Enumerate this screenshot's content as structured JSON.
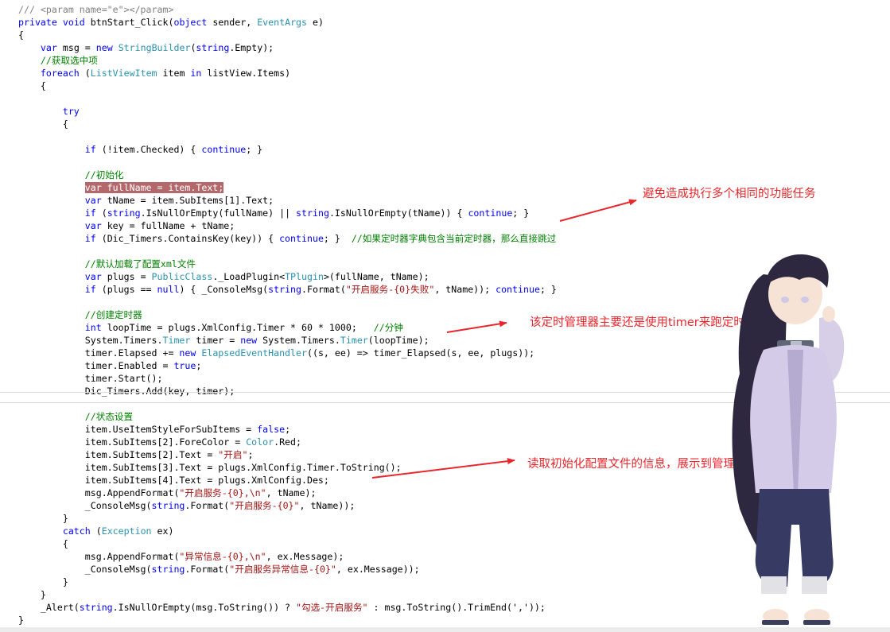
{
  "code_lines": [
    [
      [
        "doc",
        "/// <param name=\"e\"></param>"
      ]
    ],
    [
      [
        "kw",
        "private"
      ],
      [
        "t",
        " "
      ],
      [
        "kw",
        "void"
      ],
      [
        "t",
        " btnStart_Click("
      ],
      [
        "kw",
        "object"
      ],
      [
        "t",
        " sender, "
      ],
      [
        "ty",
        "EventArgs"
      ],
      [
        "t",
        " e)"
      ]
    ],
    [
      [
        "t",
        "{"
      ]
    ],
    [
      [
        "t",
        "    "
      ],
      [
        "kw",
        "var"
      ],
      [
        "t",
        " msg = "
      ],
      [
        "kw",
        "new"
      ],
      [
        "t",
        " "
      ],
      [
        "ty",
        "StringBuilder"
      ],
      [
        "t",
        "("
      ],
      [
        "kw",
        "string"
      ],
      [
        "t",
        ".Empty);"
      ]
    ],
    [
      [
        "t",
        "    "
      ],
      [
        "cmt",
        "//获取选中项"
      ]
    ],
    [
      [
        "t",
        "    "
      ],
      [
        "kw",
        "foreach"
      ],
      [
        "t",
        " ("
      ],
      [
        "ty",
        "ListViewItem"
      ],
      [
        "t",
        " item "
      ],
      [
        "kw",
        "in"
      ],
      [
        "t",
        " listView.Items)"
      ]
    ],
    [
      [
        "t",
        "    {"
      ]
    ],
    [
      [
        "t",
        ""
      ]
    ],
    [
      [
        "t",
        "        "
      ],
      [
        "kw",
        "try"
      ]
    ],
    [
      [
        "t",
        "        {"
      ]
    ],
    [
      [
        "t",
        ""
      ]
    ],
    [
      [
        "t",
        "            "
      ],
      [
        "kw",
        "if"
      ],
      [
        "t",
        " (!item.Checked) { "
      ],
      [
        "kw",
        "continue"
      ],
      [
        "t",
        "; }"
      ]
    ],
    [
      [
        "t",
        ""
      ]
    ],
    [
      [
        "t",
        "            "
      ],
      [
        "cmt",
        "//初始化"
      ]
    ],
    [
      [
        "t",
        "            "
      ],
      [
        "hl",
        "var fullName = item.Text;"
      ]
    ],
    [
      [
        "t",
        "            "
      ],
      [
        "kw",
        "var"
      ],
      [
        "t",
        " tName = item.SubItems[1].Text;"
      ]
    ],
    [
      [
        "t",
        "            "
      ],
      [
        "kw",
        "if"
      ],
      [
        "t",
        " ("
      ],
      [
        "kw",
        "string"
      ],
      [
        "t",
        ".IsNullOrEmpty(fullName) || "
      ],
      [
        "kw",
        "string"
      ],
      [
        "t",
        ".IsNullOrEmpty(tName)) { "
      ],
      [
        "kw",
        "continue"
      ],
      [
        "t",
        "; }"
      ]
    ],
    [
      [
        "t",
        "            "
      ],
      [
        "kw",
        "var"
      ],
      [
        "t",
        " key = fullName + tName;"
      ]
    ],
    [
      [
        "t",
        "            "
      ],
      [
        "kw",
        "if"
      ],
      [
        "t",
        " (Dic_Timers.ContainsKey(key)) { "
      ],
      [
        "kw",
        "continue"
      ],
      [
        "t",
        "; }  "
      ],
      [
        "cmt",
        "//如果定时器字典包含当前定时器，那么直接跳过"
      ]
    ],
    [
      [
        "t",
        ""
      ]
    ],
    [
      [
        "t",
        "            "
      ],
      [
        "cmt",
        "//默认加载了配置xml文件"
      ]
    ],
    [
      [
        "t",
        "            "
      ],
      [
        "kw",
        "var"
      ],
      [
        "t",
        " plugs = "
      ],
      [
        "ty",
        "PublicClass"
      ],
      [
        "t",
        "._LoadPlugin<"
      ],
      [
        "ty",
        "TPlugin"
      ],
      [
        "t",
        ">(fullName, tName);"
      ]
    ],
    [
      [
        "t",
        "            "
      ],
      [
        "kw",
        "if"
      ],
      [
        "t",
        " (plugs == "
      ],
      [
        "kw",
        "null"
      ],
      [
        "t",
        ") { _ConsoleMsg("
      ],
      [
        "kw",
        "string"
      ],
      [
        "t",
        ".Format("
      ],
      [
        "str",
        "\"开启服务-{0}失败\""
      ],
      [
        "t",
        ", tName)); "
      ],
      [
        "kw",
        "continue"
      ],
      [
        "t",
        "; }"
      ]
    ],
    [
      [
        "t",
        ""
      ]
    ],
    [
      [
        "t",
        "            "
      ],
      [
        "cmt",
        "//创建定时器"
      ]
    ],
    [
      [
        "t",
        "            "
      ],
      [
        "kw",
        "int"
      ],
      [
        "t",
        " loopTime = plugs.XmlConfig.Timer * 60 * 1000;   "
      ],
      [
        "cmt",
        "//分钟"
      ]
    ],
    [
      [
        "t",
        "            System.Timers."
      ],
      [
        "ty",
        "Timer"
      ],
      [
        "t",
        " timer = "
      ],
      [
        "kw",
        "new"
      ],
      [
        "t",
        " System.Timers."
      ],
      [
        "ty",
        "Timer"
      ],
      [
        "t",
        "(loopTime);"
      ]
    ],
    [
      [
        "t",
        "            timer.Elapsed += "
      ],
      [
        "kw",
        "new"
      ],
      [
        "t",
        " "
      ],
      [
        "ty",
        "ElapsedEventHandler"
      ],
      [
        "t",
        "((s, ee) => timer_Elapsed(s, ee, plugs));"
      ]
    ],
    [
      [
        "t",
        "            timer.Enabled = "
      ],
      [
        "kw",
        "true"
      ],
      [
        "t",
        ";"
      ]
    ],
    [
      [
        "t",
        "            timer.Start();"
      ]
    ],
    [
      [
        "t",
        "            Dic_Timers.Add(key, timer);"
      ]
    ],
    [
      [
        "t",
        ""
      ]
    ],
    [
      [
        "t",
        "            "
      ],
      [
        "cmt",
        "//状态设置"
      ]
    ],
    [
      [
        "t",
        "            item.UseItemStyleForSubItems = "
      ],
      [
        "kw",
        "false"
      ],
      [
        "t",
        ";"
      ]
    ],
    [
      [
        "t",
        "            item.SubItems[2].ForeColor = "
      ],
      [
        "ty",
        "Color"
      ],
      [
        "t",
        ".Red;"
      ]
    ],
    [
      [
        "t",
        "            item.SubItems[2].Text = "
      ],
      [
        "str",
        "\"开启\""
      ],
      [
        "t",
        ";"
      ]
    ],
    [
      [
        "t",
        "            item.SubItems[3].Text = plugs.XmlConfig.Timer.ToString();"
      ]
    ],
    [
      [
        "t",
        "            item.SubItems[4].Text = plugs.XmlConfig.Des;"
      ]
    ],
    [
      [
        "t",
        "            msg.AppendFormat("
      ],
      [
        "str",
        "\"开启服务-{0},\\n\""
      ],
      [
        "t",
        ", tName);"
      ]
    ],
    [
      [
        "t",
        "            _ConsoleMsg("
      ],
      [
        "kw",
        "string"
      ],
      [
        "t",
        ".Format("
      ],
      [
        "str",
        "\"开启服务-{0}\""
      ],
      [
        "t",
        ", tName));"
      ]
    ],
    [
      [
        "t",
        "        }"
      ]
    ],
    [
      [
        "t",
        "        "
      ],
      [
        "kw",
        "catch"
      ],
      [
        "t",
        " ("
      ],
      [
        "ty",
        "Exception"
      ],
      [
        "t",
        " ex)"
      ]
    ],
    [
      [
        "t",
        "        {"
      ]
    ],
    [
      [
        "t",
        "            msg.AppendFormat("
      ],
      [
        "str",
        "\"异常信息-{0},\\n\""
      ],
      [
        "t",
        ", ex.Message);"
      ]
    ],
    [
      [
        "t",
        "            _ConsoleMsg("
      ],
      [
        "kw",
        "string"
      ],
      [
        "t",
        ".Format("
      ],
      [
        "str",
        "\"开启服务异常信息-{0}\""
      ],
      [
        "t",
        ", ex.Message));"
      ]
    ],
    [
      [
        "t",
        "        }"
      ]
    ],
    [
      [
        "t",
        "    }"
      ]
    ],
    [
      [
        "t",
        "    _Alert("
      ],
      [
        "kw",
        "string"
      ],
      [
        "t",
        ".IsNullOrEmpty(msg.ToString()) ? "
      ],
      [
        "str",
        "\"勾选-开启服务\""
      ],
      [
        "t",
        " : msg.ToString().TrimEnd(','));"
      ]
    ],
    [
      [
        "t",
        "}"
      ]
    ]
  ],
  "annotations": {
    "note1": "避免造成执行多个相同的功能任务",
    "note2": "该定时管理器主要还是使用timer来跑定时跑任务",
    "note3": "读取初始化配置文件的信息，展示到管理界面"
  },
  "colors": {
    "keyword": "#0000ff",
    "type": "#2b91af",
    "string": "#a31515",
    "comment": "#008000",
    "highlight": "#b5686b",
    "annotation": "#e8262b"
  }
}
